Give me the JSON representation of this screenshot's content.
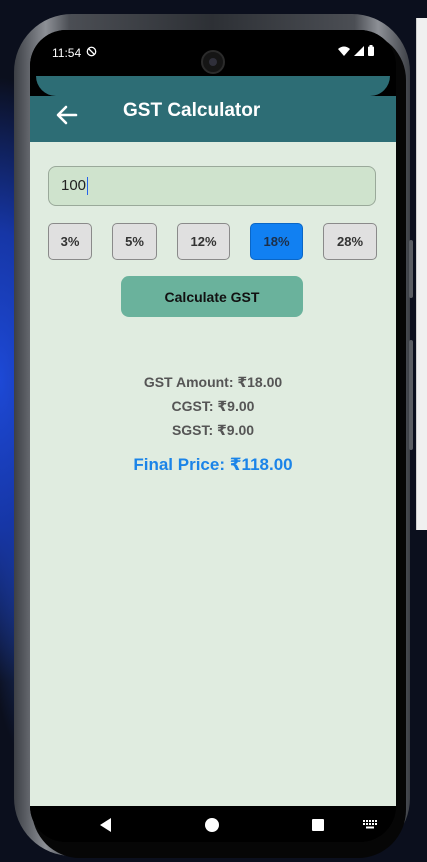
{
  "status_bar": {
    "time": "11:54"
  },
  "app_bar": {
    "title": "GST Calculator"
  },
  "amount_input": {
    "value": "100"
  },
  "rates": [
    {
      "label": "3%",
      "selected": false
    },
    {
      "label": "5%",
      "selected": false
    },
    {
      "label": "12%",
      "selected": false
    },
    {
      "label": "18%",
      "selected": true
    },
    {
      "label": "28%",
      "selected": false
    }
  ],
  "calculate_button": {
    "label": "Calculate GST"
  },
  "results": {
    "gst_amount": "GST Amount: ₹18.00",
    "cgst": "CGST: ₹9.00",
    "sgst": "SGST: ₹9.00",
    "final_price": "Final Price: ₹118.00"
  },
  "colors": {
    "app_bar": "#2d6d75",
    "background": "#e0ece0",
    "selected_rate": "#1180f2",
    "calculate_button": "#6ab29c",
    "final_price": "#1b84e8"
  },
  "icons": {
    "back": "arrow-left-icon",
    "dnd": "do-not-disturb-icon",
    "wifi": "wifi-icon",
    "signal": "signal-icon",
    "battery": "battery-icon",
    "nav_back": "triangle-back-icon",
    "nav_home": "circle-home-icon",
    "nav_recents": "square-recents-icon",
    "keyboard": "keyboard-icon"
  }
}
